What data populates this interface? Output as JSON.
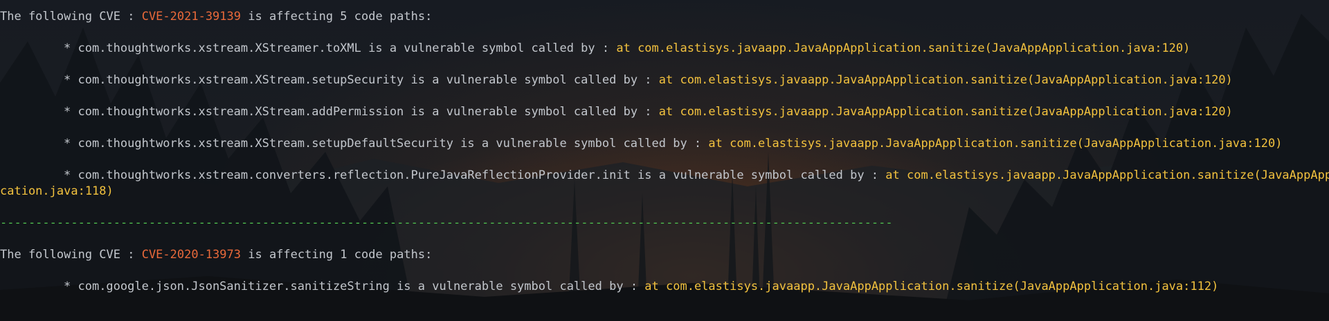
{
  "terminal": {
    "blocks": [
      {
        "prefix": "The following CVE : ",
        "cve_id": "CVE-2021-39139",
        "suffix": " is affecting 5 code paths:",
        "entries": [
          {
            "bullet": "* ",
            "symbol": "com.thoughtworks.xstream.XStreamer.toXML",
            "connector": " is a vulnerable symbol called by : ",
            "caller": "at com.elastisys.javaapp.JavaAppApplication.sanitize(JavaAppApplication.java:120)"
          },
          {
            "bullet": "* ",
            "symbol": "com.thoughtworks.xstream.XStream.setupSecurity",
            "connector": " is a vulnerable symbol called by : ",
            "caller": "at com.elastisys.javaapp.JavaAppApplication.sanitize(JavaAppApplication.java:120)"
          },
          {
            "bullet": "* ",
            "symbol": "com.thoughtworks.xstream.XStream.addPermission",
            "connector": " is a vulnerable symbol called by : ",
            "caller": "at com.elastisys.javaapp.JavaAppApplication.sanitize(JavaAppApplication.java:120)"
          },
          {
            "bullet": "* ",
            "symbol": "com.thoughtworks.xstream.XStream.setupDefaultSecurity",
            "connector": " is a vulnerable symbol called by : ",
            "caller": "at com.elastisys.javaapp.JavaAppApplication.sanitize(JavaAppApplication.java:120)"
          },
          {
            "bullet": "* ",
            "symbol": "com.thoughtworks.xstream.converters.reflection.PureJavaReflectionProvider.init",
            "connector": " is a vulnerable symbol called by : ",
            "caller": "at com.elastisys.javaapp.JavaAppApplication.sanitize(JavaAppAppli",
            "caller_wrap": "cation.java:118)"
          }
        ]
      },
      {
        "prefix": "The following CVE : ",
        "cve_id": "CVE-2020-13973",
        "suffix": " is affecting 1 code paths:",
        "entries": [
          {
            "bullet": "* ",
            "symbol": "com.google.json.JsonSanitizer.sanitizeString",
            "connector": " is a vulnerable symbol called by : ",
            "caller": "at com.elastisys.javaapp.JavaAppApplication.sanitize(JavaAppApplication.java:112)"
          }
        ]
      }
    ],
    "divider": "------------------------------------------------------------------------------------------------------------------------------",
    "colors": {
      "text": "#c3c7cd",
      "cve": "#e8693a",
      "caller": "#f3c23e",
      "divider": "#4fbf4f",
      "background": "#14171d"
    }
  }
}
